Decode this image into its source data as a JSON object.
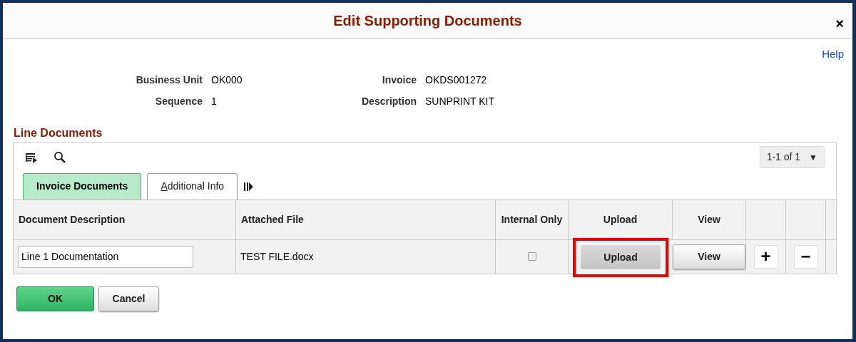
{
  "window": {
    "title": "Edit Supporting Documents",
    "close": "×"
  },
  "help_link": "Help",
  "fields": [
    {
      "label": "Business Unit",
      "value": "OK000"
    },
    {
      "label": "Invoice",
      "value": "OKDS001272"
    },
    {
      "label": "Sequence",
      "value": "1"
    },
    {
      "label": "Description",
      "value": "SUNPRINT KIT"
    }
  ],
  "section_title": "Line Documents",
  "pager": {
    "text": "1-1 of 1",
    "caret": "▼"
  },
  "tabs": [
    {
      "label": "Invoice Documents",
      "selected": true,
      "underline_first": false
    },
    {
      "label": "Additional Info",
      "selected": false,
      "underline_first": true
    }
  ],
  "table": {
    "columns": [
      "Document Description",
      "Attached File",
      "Internal Only",
      "Upload",
      "View"
    ],
    "rows": [
      {
        "description": "Line 1 Documentation",
        "attached_file": "TEST FILE.docx",
        "internal_only": false,
        "upload": {
          "label": "Upload",
          "highlighted": true
        },
        "view": "View",
        "add": "+",
        "remove": "−"
      }
    ]
  },
  "buttons": [
    {
      "label": "OK",
      "kind": "primary"
    },
    {
      "label": "Cancel",
      "kind": "secondary"
    }
  ]
}
